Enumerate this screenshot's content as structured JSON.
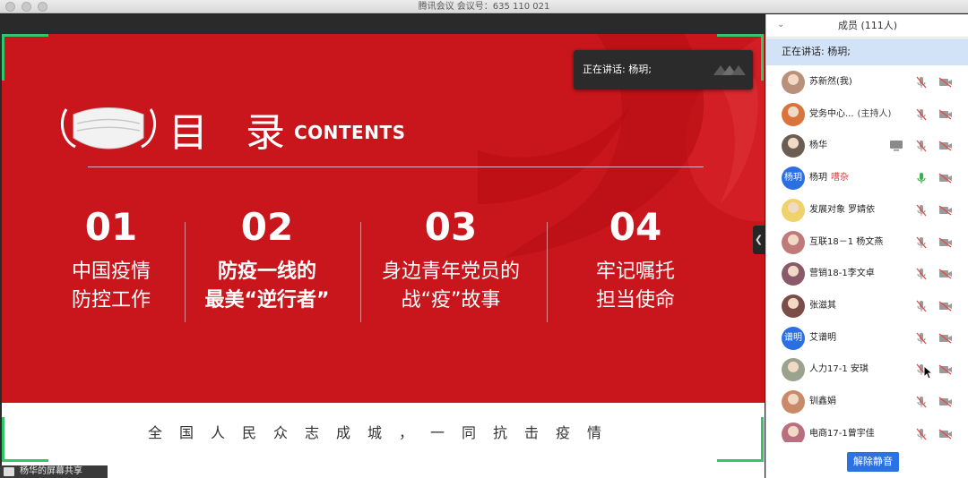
{
  "window": {
    "title": "腾讯会议 会议号：635 110 021"
  },
  "slide": {
    "title": "目 录",
    "subtitle": "CONTENTS",
    "items": [
      {
        "num": "01",
        "line1": "中国疫情",
        "line2": "防控工作"
      },
      {
        "num": "02",
        "line1": "防疫一线的",
        "line2": "最美“逆行者”"
      },
      {
        "num": "03",
        "line1": "身边青年党员的",
        "line2": "战“疫”故事"
      },
      {
        "num": "04",
        "line1": "牢记嘱托",
        "line2": "担当使命"
      }
    ],
    "slogan": "全国人民众志成城，一同抗击疫情",
    "colors": {
      "red": "#c9161c",
      "corner_green": "#2fc76a"
    }
  },
  "speaker_popup": {
    "label": "正在讲话: 杨玥;"
  },
  "share_bar": {
    "label": "杨华的屏幕共享"
  },
  "panel": {
    "header": "成员 (111人)",
    "now_speaking": "正在讲话: 杨玥;",
    "members": [
      {
        "name": "苏新然(我)",
        "role": "",
        "avatar": "photo",
        "mic": "muted",
        "screen": false
      },
      {
        "name": "党务中心...",
        "role": "(主持人)",
        "avatar": "photo",
        "mic": "muted",
        "screen": false
      },
      {
        "name": "杨华",
        "role": "",
        "avatar": "photo",
        "mic": "muted",
        "screen": true
      },
      {
        "name": "杨玥",
        "role": "",
        "noisy": "嘈杂",
        "avatar": "text",
        "avatar_text": "杨玥",
        "mic": "active",
        "screen": false
      },
      {
        "name": "发展对象 罗婧依",
        "role": "",
        "avatar": "photo",
        "mic": "muted",
        "screen": false
      },
      {
        "name": "互联18－1 杨文燕",
        "role": "",
        "avatar": "photo",
        "mic": "muted",
        "screen": false
      },
      {
        "name": "营销18-1李文卓",
        "role": "",
        "avatar": "photo",
        "mic": "muted",
        "screen": false
      },
      {
        "name": "张滋其",
        "role": "",
        "avatar": "photo",
        "mic": "muted",
        "screen": false
      },
      {
        "name": "艾谱明",
        "role": "",
        "avatar": "text",
        "avatar_text": "谱明",
        "mic": "muted",
        "screen": false
      },
      {
        "name": "人力17-1 安琪",
        "role": "",
        "avatar": "photo",
        "mic": "muted",
        "screen": false
      },
      {
        "name": "钏鑫娟",
        "role": "",
        "avatar": "photo",
        "mic": "muted",
        "screen": false
      },
      {
        "name": "电商17-1曾宇佳",
        "role": "",
        "avatar": "photo",
        "mic": "muted",
        "screen": false
      }
    ],
    "unmute_all_button": "解除静音"
  }
}
